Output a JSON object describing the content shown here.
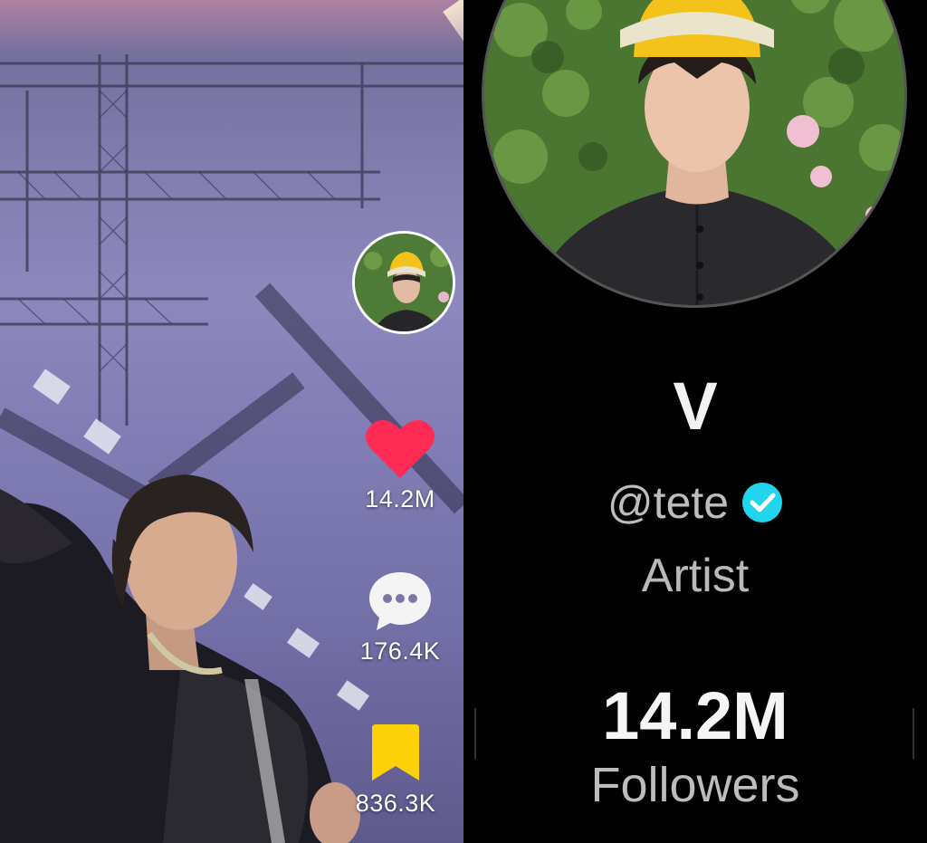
{
  "video": {
    "actions": {
      "likes": "14.2M",
      "comments": "176.4K",
      "saves": "836.3K"
    }
  },
  "profile": {
    "display_name": "V",
    "handle": "@tete",
    "bio": "Artist",
    "followers_count": "14.2M",
    "followers_label": "Followers"
  },
  "colors": {
    "like": "#fe2c55",
    "save": "#fdd10a",
    "verified": "#20d5ec"
  },
  "icons": {
    "like": "heart-icon",
    "comment": "comment-bubble-icon",
    "save": "bookmark-icon",
    "verified": "verified-badge-icon"
  }
}
